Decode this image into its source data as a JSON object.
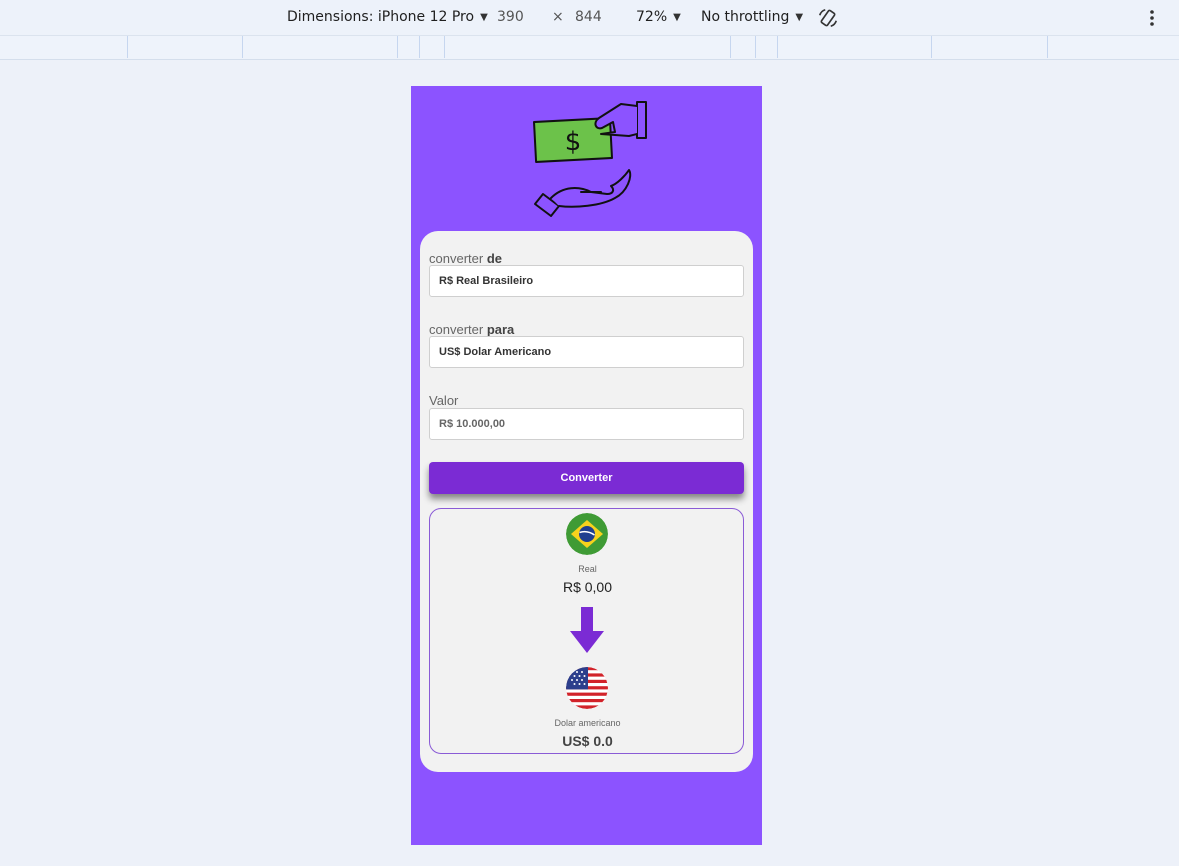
{
  "devtools": {
    "device_label": "Dimensions: iPhone 12 Pro",
    "width": "390",
    "height": "844",
    "times": "×",
    "zoom": "72%",
    "throttling": "No throttling"
  },
  "form": {
    "from_label_prefix": "converter",
    "from_label_strong": "de",
    "from_value": "R$ Real Brasileiro",
    "to_label_prefix": "converter",
    "to_label_strong": "para",
    "to_value": "US$ Dolar Americano",
    "amount_label": "Valor",
    "amount_placeholder": "R$ 10.000,00",
    "convert_button": "Converter"
  },
  "result": {
    "from_flag_icon": "brazil-flag-icon",
    "from_currency_name": "Real",
    "from_amount": "R$ 0,00",
    "arrow_icon": "arrow-down-icon",
    "to_flag_icon": "usa-flag-icon",
    "to_currency_name": "Dolar americano",
    "to_amount": "US$ 0.0"
  },
  "colors": {
    "phone_background": "#8c53ff",
    "button": "#7b2bd4",
    "arrow": "#7b2bd4",
    "money_green": "#6cc24a"
  }
}
